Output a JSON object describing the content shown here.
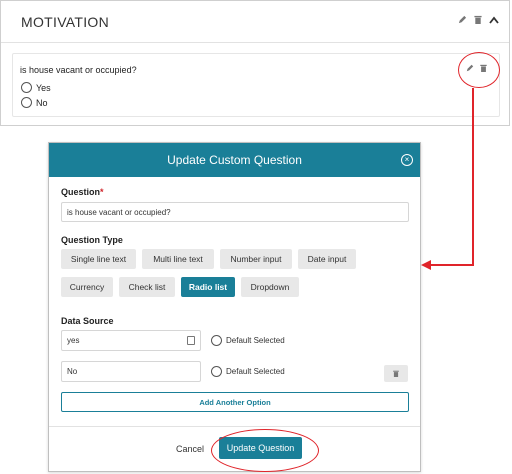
{
  "card": {
    "title": "MOTIVATION",
    "question_text": "is house vacant or occupied?",
    "options": [
      "Yes",
      "No"
    ],
    "header_icons": [
      "pencil-icon",
      "trash-icon",
      "chevron-up-icon"
    ],
    "question_icons": [
      "pencil-icon",
      "trash-icon"
    ]
  },
  "modal": {
    "title": "Update Custom Question",
    "question_label": "Question",
    "required_mark": "*",
    "question_value": "is house vacant or occupied?",
    "question_type_label": "Question Type",
    "types": [
      "Single line text",
      "Multi line text",
      "Number input",
      "Date input",
      "Currency",
      "Check list",
      "Radio list",
      "Dropdown"
    ],
    "selected_type": "Radio list",
    "data_source_label": "Data Source",
    "options": [
      {
        "value": "yes",
        "default_label": "Default Selected"
      },
      {
        "value": "No",
        "default_label": "Default Selected"
      }
    ],
    "add_option_label": "Add Another Option",
    "cancel_label": "Cancel",
    "update_label": "Update Question"
  },
  "colors": {
    "accent": "#1a7f98",
    "annotation": "#e0242a",
    "chip_bg": "#e8e8e8"
  }
}
